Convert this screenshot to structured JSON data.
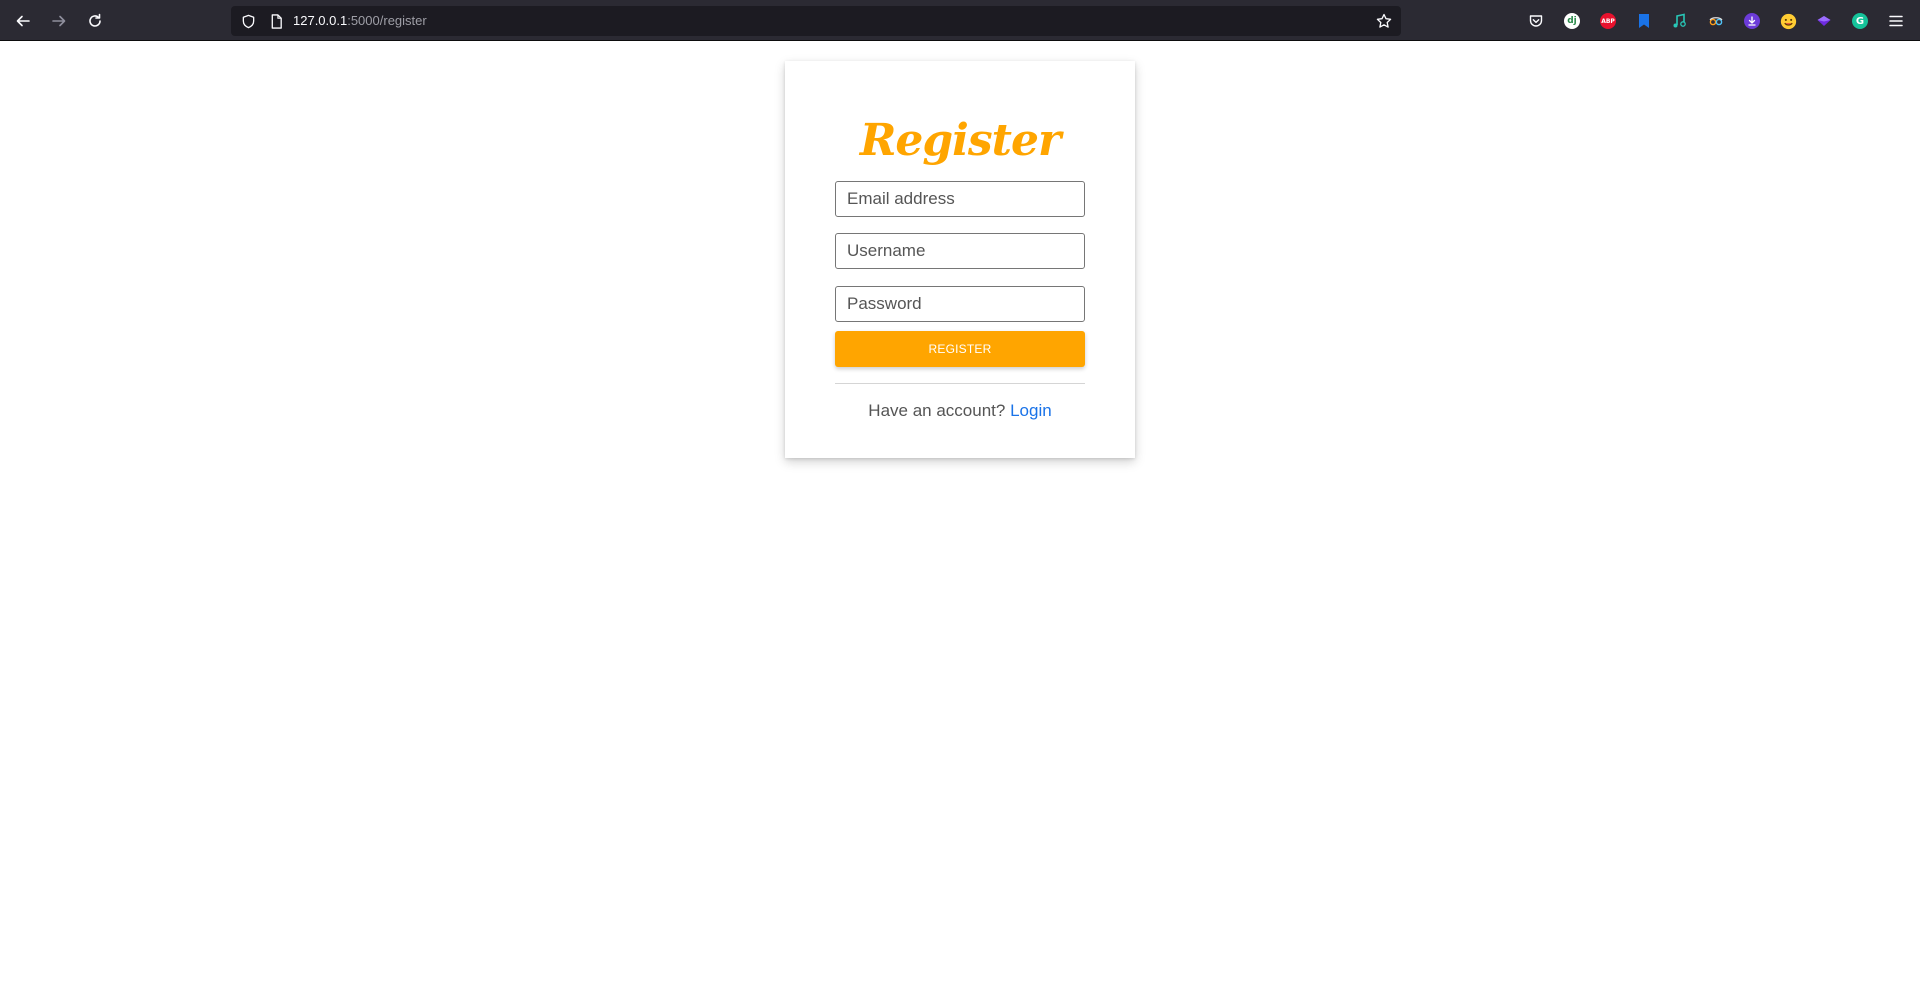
{
  "browser": {
    "url_host": "127.0.0.1",
    "url_rest": ":5000/register",
    "extensions": [
      {
        "name": "pocket-icon",
        "color": "#fbfbfe"
      },
      {
        "name": "dj-extension-icon",
        "color": "#ffffff",
        "label": "dj"
      },
      {
        "name": "adblock-plus-icon",
        "color": "#e8112d",
        "label": "ABP"
      },
      {
        "name": "bookmark-extension-icon",
        "color": "#1a73e8"
      },
      {
        "name": "music-extension-icon",
        "color": "#28c7b7"
      },
      {
        "name": "mask-extension-icon",
        "color": "#ff9f1a"
      },
      {
        "name": "download-extension-icon",
        "color": "#6c3bd9"
      },
      {
        "name": "emoji-extension-icon",
        "color": "#ffcc33"
      },
      {
        "name": "shield-extension-icon",
        "color": "#6f2be0"
      },
      {
        "name": "grammarly-icon",
        "color": "#15c39a",
        "label": "G"
      },
      {
        "name": "menu-icon",
        "color": "#fbfbfe"
      }
    ]
  },
  "register": {
    "title": "Register",
    "email_placeholder": "Email address",
    "username_placeholder": "Username",
    "password_placeholder": "Password",
    "button_label": "REGISTER",
    "footer_text": "Have an account?",
    "login_link": "Login"
  },
  "colors": {
    "accent": "#ffa500",
    "link": "#1a73e8"
  }
}
